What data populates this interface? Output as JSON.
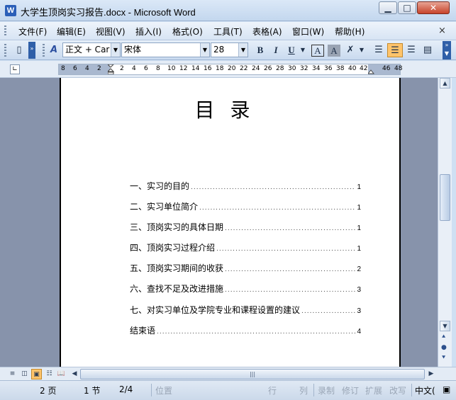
{
  "window": {
    "title": "大学生顶岗实习报告.docx - Microsoft Word",
    "app_icon": "W",
    "minimize_icon": "minimize-icon",
    "maximize_icon": "maximize-icon",
    "close_icon": "close-icon"
  },
  "menu": {
    "items": [
      "文件(F)",
      "编辑(E)",
      "视图(V)",
      "插入(I)",
      "格式(O)",
      "工具(T)",
      "表格(A)",
      "窗口(W)",
      "帮助(H)"
    ],
    "close_doc": "×"
  },
  "toolbar": {
    "style_value": "正文 + Car",
    "font_value": "宋体",
    "size_value": "28",
    "bold": "B",
    "italic": "I",
    "underline": "U",
    "border_a": "A",
    "shade_a": "A",
    "active_alignment": "center"
  },
  "ruler": {
    "numbers": [
      "8",
      "6",
      "4",
      "2",
      "2",
      "4",
      "6",
      "8",
      "10",
      "12",
      "14",
      "16",
      "18",
      "20",
      "22",
      "24",
      "26",
      "28",
      "30",
      "32",
      "34",
      "36",
      "38",
      "40",
      "42",
      "46",
      "48"
    ]
  },
  "document": {
    "heading": "目录",
    "toc": [
      {
        "text": "一、实习的目的",
        "page": "1"
      },
      {
        "text": "二、实习单位简介",
        "page": "1"
      },
      {
        "text": "三、顶岗实习的具体日期",
        "page": "1"
      },
      {
        "text": "四、顶岗实习过程介绍",
        "page": "1"
      },
      {
        "text": "五、顶岗实习期间的收获",
        "page": "2"
      },
      {
        "text": "六、查找不足及改进措施",
        "page": "3"
      },
      {
        "text": "七、对实习单位及学院专业和课程设置的建议",
        "page": "3"
      },
      {
        "text": "结束语",
        "page": "4"
      }
    ]
  },
  "statusbar": {
    "page": "2 页",
    "section": "1 节",
    "page_of": "2/4",
    "position": "位置",
    "line": "行",
    "column": "列",
    "record": "录制",
    "revision": "修订",
    "extend": "扩展",
    "overtype": "改写",
    "language": "中文("
  }
}
